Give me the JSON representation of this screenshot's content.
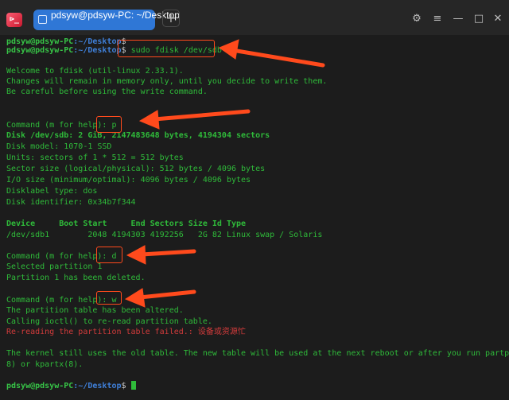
{
  "app": {
    "icon_glyph": "⊳_",
    "tab_title": "pdsyw@pdsyw-PC: ~/Desktop",
    "new_tab_glyph": "+"
  },
  "window_controls": {
    "settings_glyph": "⚙",
    "menu_glyph": "≡",
    "minimize_glyph": "—",
    "maximize_glyph": "□",
    "close_glyph": "✕"
  },
  "prompt": {
    "user": "pdsyw@pdsyw-PC",
    "path": ":~/Desktop",
    "symbol": "$"
  },
  "terminal": {
    "command_1": "",
    "command_2": " sudo fdisk /dev/sdb",
    "welcome_1": "Welcome to fdisk (util-linux 2.33.1).",
    "welcome_2": "Changes will remain in memory only, until you decide to write them.",
    "welcome_3": "Be careful before using the write command.",
    "cmd_prompt": "Command (m for help): ",
    "cmd_p": "p",
    "disk_line": "Disk /dev/sdb: 2 GiB, 2147483648 bytes, 4194304 sectors",
    "disk_model": "Disk model: 1070-1 SSD",
    "units": "Units: sectors of 1 * 512 = 512 bytes",
    "sector_size": "Sector size (logical/physical): 512 bytes / 4096 bytes",
    "io_size": "I/O size (minimum/optimal): 4096 bytes / 4096 bytes",
    "label_type": "Disklabel type: dos",
    "identifier": "Disk identifier: 0x34b7f344",
    "table_header": "Device     Boot Start     End Sectors Size Id Type",
    "table_row": "/dev/sdb1        2048 4194303 4192256   2G 82 Linux swap / Solaris",
    "cmd_d": "d",
    "selected": "Selected partition 1",
    "deleted": "Partition 1 has been deleted.",
    "cmd_w": "w",
    "altered": "The partition table has been altered.",
    "ioctl": "Calling ioctl() to re-read partition table.",
    "reread_failed": "Re-reading the partition table failed.: 设备或资源忙",
    "kernel_1": "The kernel still uses the old table. The new table will be used at the next reboot or after you run partprobe(",
    "kernel_2": "8) or kpartx(8)."
  },
  "colors": {
    "terminal_green": "#2fbb3a",
    "prompt_path_blue": "#3f7fd8",
    "error_red": "#d23b3b",
    "annotation_red": "#ff4a1c",
    "tab_blue": "#2f77d6"
  }
}
